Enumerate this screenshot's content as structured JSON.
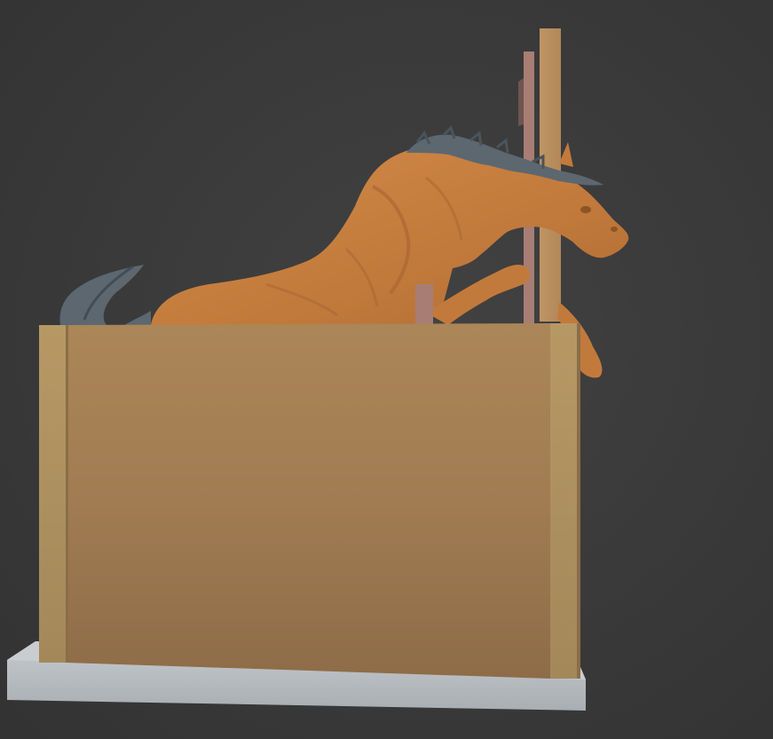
{
  "viewport": {
    "background_color": "#3b3b3b",
    "scene_objects": [
      {
        "name": "base-plate",
        "color": "#b4b9bd"
      },
      {
        "name": "display-box-front",
        "color": "#a57f55"
      },
      {
        "name": "left-post",
        "color": "#b39361"
      },
      {
        "name": "right-post",
        "color": "#b39361"
      },
      {
        "name": "tall-board",
        "color": "#b8895a"
      },
      {
        "name": "pink-bar",
        "color": "#a87e74"
      },
      {
        "name": "short-pink-post",
        "color": "#a87e74"
      },
      {
        "name": "horse-sculpture",
        "color": "#c67d3e"
      },
      {
        "name": "mane",
        "color": "#5c6770"
      },
      {
        "name": "tail",
        "color": "#5c6770"
      }
    ]
  }
}
